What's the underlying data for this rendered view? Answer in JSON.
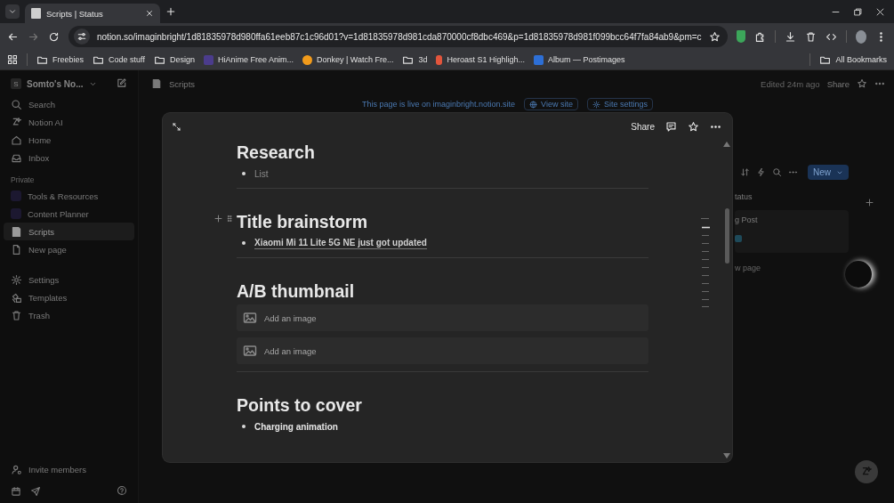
{
  "browser": {
    "tab": {
      "title": "Scripts | Status"
    },
    "url": "notion.so/imaginbright/1d81835978d980ffa61eeb87c1c96d01?v=1d81835978d981cda870000cf8dbc469&p=1d81835978d981f099bcc64f7fa84ab9&pm=c",
    "bookmarks": [
      {
        "label": "Freebies",
        "kind": "folder"
      },
      {
        "label": "Code stuff",
        "kind": "folder"
      },
      {
        "label": "Design",
        "kind": "folder"
      },
      {
        "label": "HiAnime Free Anim...",
        "kind": "site",
        "color": "#4b3c8c"
      },
      {
        "label": "Donkey | Watch Fre...",
        "kind": "play",
        "color": "#f29b1b"
      },
      {
        "label": "3d",
        "kind": "folder"
      },
      {
        "label": "Heroast S1 Highligh...",
        "kind": "figma",
        "color": "#e2553c"
      },
      {
        "label": "Album — Postimages",
        "kind": "site",
        "color": "#2d6fd6"
      }
    ],
    "all_bookmarks": "All Bookmarks"
  },
  "sidebar": {
    "workspace": "Somto's No...",
    "workspace_initial": "S",
    "nav": [
      {
        "label": "Search",
        "kind": "search"
      },
      {
        "label": "Notion AI",
        "kind": "ai"
      },
      {
        "label": "Home",
        "kind": "home"
      },
      {
        "label": "Inbox",
        "kind": "inbox"
      }
    ],
    "section": "Private",
    "pages": [
      {
        "label": "Tools & Resources",
        "kind": "emoji",
        "selected": false
      },
      {
        "label": "Content Planner",
        "kind": "emoji",
        "selected": false
      },
      {
        "label": "Scripts",
        "kind": "doc",
        "selected": true
      },
      {
        "label": "New page",
        "kind": "page",
        "selected": false
      }
    ],
    "utility": [
      {
        "label": "Settings",
        "kind": "settings"
      },
      {
        "label": "Templates",
        "kind": "templates"
      },
      {
        "label": "Trash",
        "kind": "trash"
      }
    ],
    "invite": "Invite members"
  },
  "topbar": {
    "breadcrumb": "Scripts",
    "edited": "Edited 24m ago",
    "share": "Share"
  },
  "banner": {
    "text": "This page is live on imaginbright.notion.site",
    "buttons": [
      "View site",
      "Site settings"
    ]
  },
  "board": {
    "column_header": "tatus",
    "card_title": "g Post",
    "new_page": "w page",
    "new_button": "New"
  },
  "modal": {
    "share": "Share",
    "blocks": [
      {
        "kind": "heading",
        "text": "Research"
      },
      {
        "kind": "placeholder_bullet",
        "text": "List"
      },
      {
        "kind": "divider"
      },
      {
        "kind": "heading",
        "text": "Title brainstorm",
        "hovered": true
      },
      {
        "kind": "link_bullet",
        "text": "Xiaomi Mi 11 Lite 5G NE just got updated"
      },
      {
        "kind": "divider"
      },
      {
        "kind": "heading",
        "text": "A/B thumbnail"
      },
      {
        "kind": "image",
        "text": "Add an image"
      },
      {
        "kind": "image",
        "text": "Add an image"
      },
      {
        "kind": "divider"
      },
      {
        "kind": "heading",
        "text": "Points to cover"
      },
      {
        "kind": "bullet",
        "text": "Charging animation"
      }
    ]
  }
}
